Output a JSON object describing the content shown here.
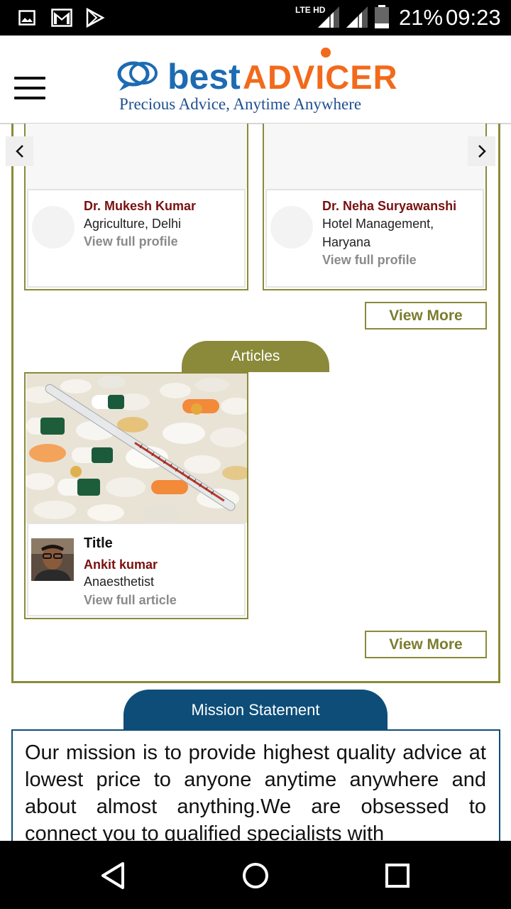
{
  "status_bar": {
    "network": "LTE HD",
    "battery": "21%",
    "time": "09:23"
  },
  "header": {
    "logo_word1": "best",
    "logo_word2": "ADVICER",
    "tagline": "Precious Advice, Anytime Anywhere"
  },
  "advisors": [
    {
      "name": "Dr. Mukesh Kumar",
      "specialty": "Agriculture, Delhi",
      "link": "View full profile"
    },
    {
      "name": "Dr. Neha Suryawanshi",
      "specialty": "Hotel Management, Haryana",
      "link": "View full profile"
    }
  ],
  "advisors_view_more": "View More",
  "articles": {
    "section_title": "Articles",
    "items": [
      {
        "title": "Title",
        "author": "Ankit kumar",
        "role": "Anaesthetist",
        "link": "View full article"
      }
    ],
    "view_more": "View More"
  },
  "mission": {
    "title": "Mission Statement",
    "text": "Our mission is to provide highest quality advice at lowest price to anyone anytime anywhere and about almost anything.We are obsessed to connect you to qualified specialists with"
  },
  "colors": {
    "olive": "#8a8a3a",
    "navy": "#0e4d78",
    "name_red": "#7a1010",
    "logo_blue": "#1c6bb3",
    "logo_orange": "#f26a1b"
  }
}
